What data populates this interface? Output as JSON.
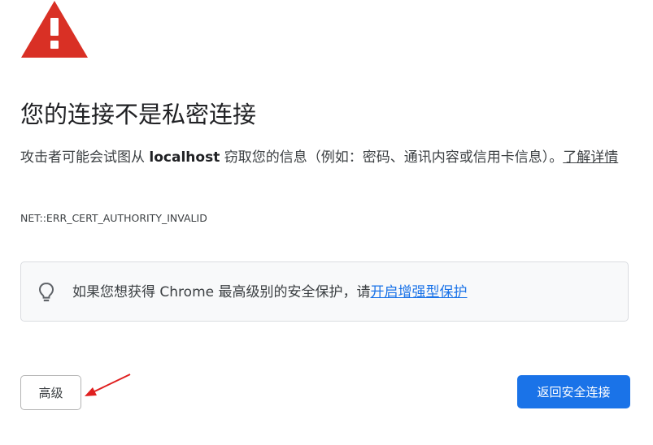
{
  "title": "您的连接不是私密连接",
  "message": {
    "before_host": "攻击者可能会试图从 ",
    "host": "localhost",
    "after_host": " 窃取您的信息（例如：密码、通讯内容或信用卡信息）。",
    "learn_more": "了解详情"
  },
  "error_code": "NET::ERR_CERT_AUTHORITY_INVALID",
  "promo": {
    "icon": "lightbulb-icon",
    "text": "如果您想获得 Chrome 最高级别的安全保护，请",
    "link": "开启增强型保护"
  },
  "buttons": {
    "advanced": "高级",
    "back_to_safety": "返回安全连接"
  },
  "colors": {
    "warning_red": "#d93025",
    "link_blue": "#1a73e8",
    "primary_button": "#1a73e8",
    "annotation_arrow": "#e02020"
  }
}
